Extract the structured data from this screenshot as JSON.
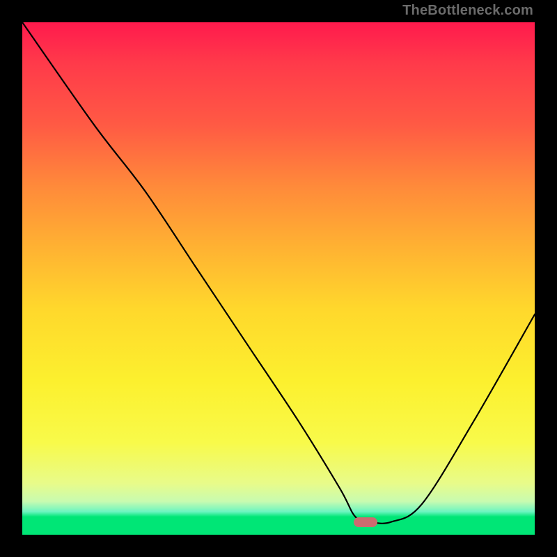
{
  "watermark": "TheBottleneck.com",
  "colors": {
    "frame": "#000000",
    "curve": "#000000",
    "marker": "#cc6b70",
    "gradient_top": "#ff1a4d",
    "gradient_bottom": "#00e676"
  },
  "chart_data": {
    "type": "line",
    "title": "",
    "xlabel": "",
    "ylabel": "",
    "xlim": [
      0,
      100
    ],
    "ylim": [
      0,
      100
    ],
    "grid": false,
    "series": [
      {
        "name": "bottleneck_curve",
        "x": [
          0,
          14,
          24,
          34,
          44,
          54,
          62,
          65,
          68,
          72,
          78,
          88,
          100
        ],
        "values": [
          100,
          80,
          67,
          52,
          37,
          22,
          9,
          3.5,
          2.5,
          2.5,
          6,
          22,
          43
        ]
      }
    ],
    "marker": {
      "x": 67,
      "y": 2.5
    },
    "annotations": []
  }
}
